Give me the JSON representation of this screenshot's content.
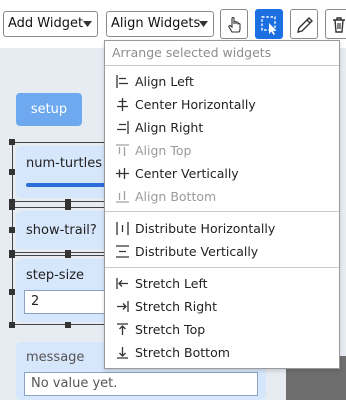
{
  "toolbar": {
    "add_widget_label": "Add Widget",
    "align_widgets_label": "Align Widgets",
    "icons": [
      "interact-hand-icon",
      "select-cursor-icon",
      "edit-pencil-icon",
      "delete-trash-icon"
    ],
    "accent_color": "#1c6fe0"
  },
  "menu": {
    "header": "Arrange selected widgets",
    "align_items": [
      {
        "label": "Align Left",
        "icon": "align-left-icon",
        "enabled": true
      },
      {
        "label": "Center Horizontally",
        "icon": "center-horizontal-icon",
        "enabled": true
      },
      {
        "label": "Align Right",
        "icon": "align-right-icon",
        "enabled": true
      },
      {
        "label": "Align Top",
        "icon": "align-top-icon",
        "enabled": false
      },
      {
        "label": "Center Vertically",
        "icon": "center-vertical-icon",
        "enabled": true
      },
      {
        "label": "Align Bottom",
        "icon": "align-bottom-icon",
        "enabled": false
      }
    ],
    "distribute_items": [
      {
        "label": "Distribute Horizontally",
        "icon": "distribute-horizontal-icon",
        "enabled": true
      },
      {
        "label": "Distribute Vertically",
        "icon": "distribute-vertical-icon",
        "enabled": true
      }
    ],
    "stretch_items": [
      {
        "label": "Stretch Left",
        "icon": "stretch-left-icon",
        "enabled": true
      },
      {
        "label": "Stretch Right",
        "icon": "stretch-right-icon",
        "enabled": true
      },
      {
        "label": "Stretch Top",
        "icon": "stretch-top-icon",
        "enabled": true
      },
      {
        "label": "Stretch Bottom",
        "icon": "stretch-bottom-icon",
        "enabled": true
      }
    ]
  },
  "widgets": {
    "setup_label": "setup",
    "num_turtles_label": "num-turtles",
    "show_trail_label": "show-trail?",
    "step_size_label": "step-size",
    "step_size_value": "2",
    "message_label": "message",
    "message_value": "No value yet."
  }
}
